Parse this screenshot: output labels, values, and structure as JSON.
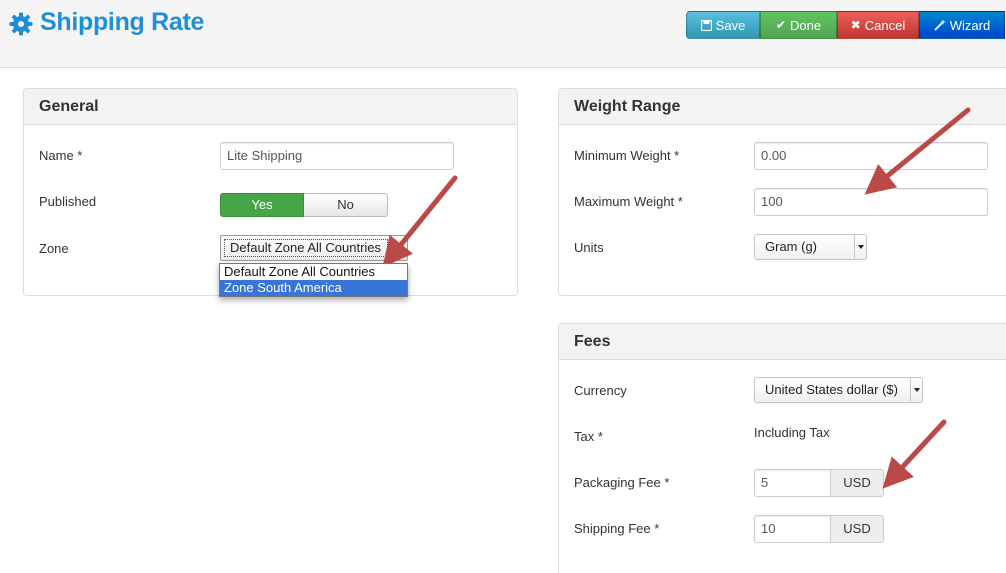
{
  "header": {
    "title": "Shipping Rate",
    "toolbar": {
      "save_label": "Save",
      "done_label": "Done",
      "cancel_label": "Cancel",
      "wizard_label": "Wizard"
    }
  },
  "general": {
    "heading": "General",
    "name_label": "Name *",
    "name_value": "Lite Shipping",
    "published_label": "Published",
    "published_yes": "Yes",
    "published_no": "No",
    "published_selected": "Yes",
    "zone_label": "Zone",
    "zone_value": "Default Zone All Countries",
    "zone_options": [
      "Default Zone All Countries",
      "Zone South America"
    ],
    "zone_highlighted": "Zone South America"
  },
  "weight_range": {
    "heading": "Weight Range",
    "min_label": "Minimum Weight *",
    "min_value": "0.00",
    "max_label": "Maximum Weight *",
    "max_value": "100",
    "units_label": "Units",
    "units_value": "Gram (g)"
  },
  "fees": {
    "heading": "Fees",
    "currency_label": "Currency",
    "currency_value": "United States dollar ($)",
    "tax_label": "Tax *",
    "tax_value": "Including Tax",
    "packaging_label": "Packaging Fee *",
    "packaging_value": "5",
    "packaging_unit": "USD",
    "shipping_label": "Shipping Fee *",
    "shipping_value": "10",
    "shipping_unit": "USD"
  },
  "colors": {
    "title_blue": "#1f8fd6",
    "save": "#49afcd",
    "done": "#5bb75b",
    "cancel": "#da4f49",
    "wizard": "#006dcc",
    "toggle_yes": "#46a546",
    "selection": "#3875d7",
    "annotation_arrow": "#b94a48"
  }
}
